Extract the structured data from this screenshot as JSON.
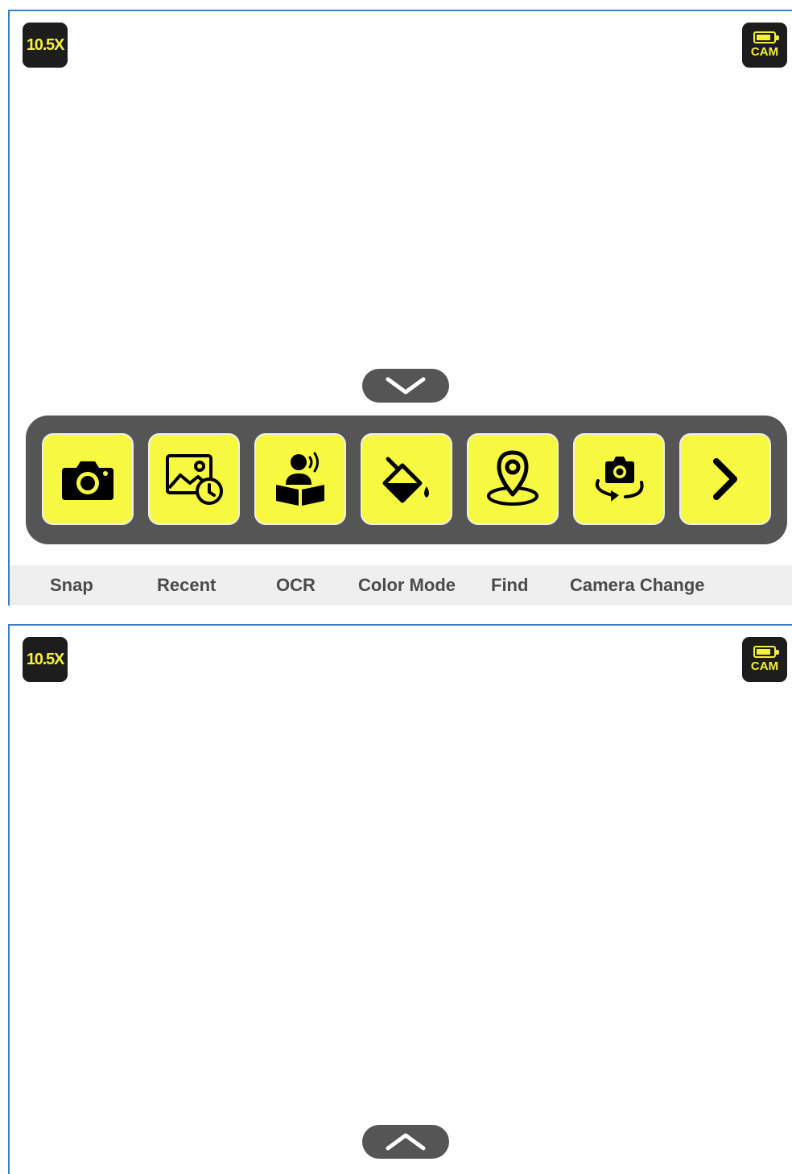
{
  "screens": [
    {
      "zoom": "10.5X",
      "camera_badge": "CAM",
      "collapse_icon": "chevron-down-icon",
      "toolbar": [
        {
          "icon": "camera-icon",
          "label": "Snap"
        },
        {
          "icon": "gallery-clock-icon",
          "label": "Recent"
        },
        {
          "icon": "reader-speaking-icon",
          "label": "OCR"
        },
        {
          "icon": "paint-bucket-icon",
          "label": "Color Mode"
        },
        {
          "icon": "location-pin-icon",
          "label": "Find"
        },
        {
          "icon": "camera-rotate-icon",
          "label": "Camera Change"
        },
        {
          "icon": "chevron-right-icon",
          "label": ""
        }
      ]
    },
    {
      "zoom": "10.5X",
      "camera_badge": "CAM",
      "expand_icon": "chevron-up-icon"
    }
  ],
  "colors": {
    "accent_yellow": "#f7f941",
    "badge_text_yellow": "#f7f03a",
    "toolbar_gray": "#555555",
    "badge_black": "#1d1d1d",
    "label_bar": "#efefef",
    "border_blue": "#3a7fc6"
  }
}
